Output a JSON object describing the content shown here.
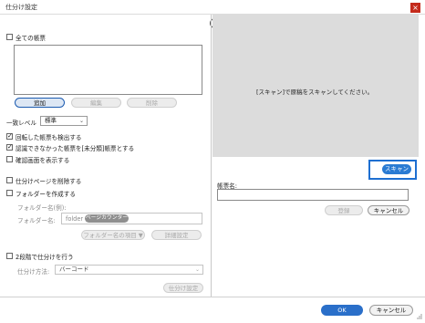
{
  "window": {
    "title": "仕分け設定",
    "close_label": "×"
  },
  "help_icon": "?",
  "all_forms": {
    "label": "全ての帳票",
    "checked": false
  },
  "form_buttons": {
    "add": "追加",
    "edit": "編集",
    "delete": "削除"
  },
  "match_level": {
    "label": "一致レベル",
    "value": "標準"
  },
  "options": [
    {
      "label": "回転した帳票も検出する",
      "checked": true
    },
    {
      "label": "認識できなかった帳票を[未分類]帳票とする",
      "checked": true
    },
    {
      "label": "確認画面を表示する",
      "checked": false
    }
  ],
  "delete_pages": {
    "label": "仕分けページを削除する",
    "checked": false
  },
  "create_folder": {
    "label": "フォルダーを作成する",
    "checked": false
  },
  "folder_example_label": "フォルダー名(例):",
  "folder_name": {
    "label": "フォルダー名:",
    "prefix": "folder",
    "chip": "ページカウンター"
  },
  "folder_buttons": {
    "item": "フォルダー名の項目 ▼",
    "detail": "詳細設定"
  },
  "two_stage": {
    "label": "2段階で仕分けを行う",
    "checked": false
  },
  "sort_method": {
    "label": "仕分け方法:",
    "value": "バーコード"
  },
  "sort_settings_button": "仕分け設定",
  "preview": {
    "message": "[スキャン]で原稿をスキャンしてください。"
  },
  "scan_button": "スキャン",
  "form_name": {
    "label": "帳票名:",
    "value": ""
  },
  "register_button": "登録",
  "right_cancel_button": "キャンセル",
  "footer": {
    "ok": "OK",
    "cancel": "キャンセル"
  }
}
